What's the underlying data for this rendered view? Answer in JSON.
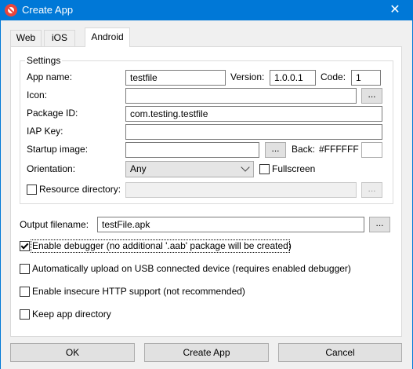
{
  "window": {
    "title": "Create App",
    "close_glyph": "✕"
  },
  "tabs": [
    {
      "label": "Web"
    },
    {
      "label": "iOS"
    },
    {
      "label": "Android",
      "active": true
    }
  ],
  "settings": {
    "group_label": "Settings",
    "app_name_label": "App name:",
    "app_name_value": "testfile",
    "version_label": "Version:",
    "version_value": "1.0.0.1",
    "code_label": "Code:",
    "code_value": "1",
    "icon_label": "Icon:",
    "icon_value": "",
    "icon_browse": "...",
    "package_label": "Package ID:",
    "package_value": "com.testing.testfile",
    "iap_label": "IAP Key:",
    "iap_value": "",
    "startup_label": "Startup image:",
    "startup_value": "",
    "startup_browse": "...",
    "back_label": "Back:",
    "back_value": "#FFFFFF",
    "back_color": "#FFFFFF",
    "orientation_label": "Orientation:",
    "orientation_value": "Any",
    "fullscreen_label": "Fullscreen",
    "fullscreen_checked": false,
    "resource_label": "Resource directory:",
    "resource_checked": false,
    "resource_value": "",
    "resource_browse": "..."
  },
  "output": {
    "label": "Output filename:",
    "value": "testFile.apk",
    "browse": "..."
  },
  "options": [
    {
      "label": "Enable debugger (no additional '.aab' package will be created)",
      "checked": true
    },
    {
      "label": "Automatically upload on USB connected device (requires enabled debugger)",
      "checked": false
    },
    {
      "label": "Enable insecure HTTP support (not recommended)",
      "checked": false
    },
    {
      "label": "Keep app directory",
      "checked": false
    }
  ],
  "buttons": {
    "ok": "OK",
    "create": "Create App",
    "cancel": "Cancel"
  }
}
